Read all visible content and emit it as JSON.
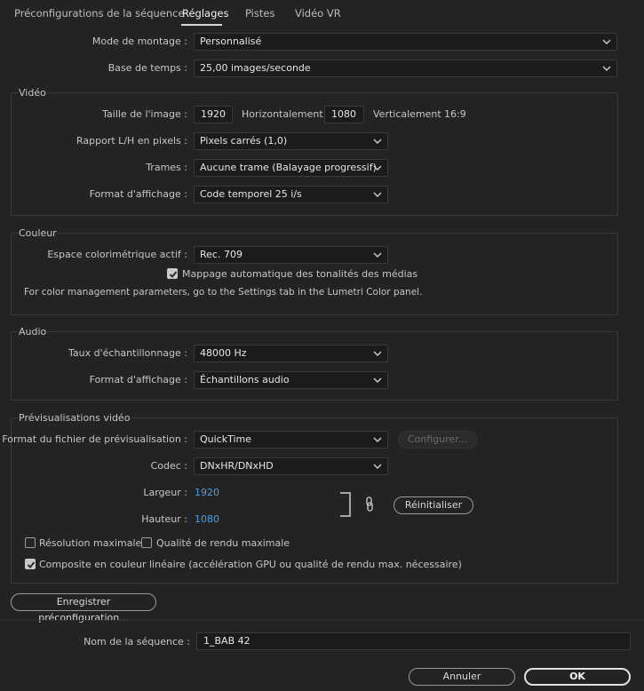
{
  "tabs": [
    {
      "label": "Préconfigurations de la séquence"
    },
    {
      "label": "Réglages"
    },
    {
      "label": "Pistes"
    },
    {
      "label": "Vidéo VR"
    }
  ],
  "general": {
    "editing_mode_label": "Mode de montage :",
    "editing_mode_value": "Personnalisé",
    "timebase_label": "Base de temps :",
    "timebase_value": "25,00  images/seconde"
  },
  "video": {
    "title": "Vidéo",
    "frame_size_label": "Taille de l'image :",
    "width_value": "1920",
    "horizontal_label": "Horizontalement",
    "height_value": "1080",
    "vertical_label": "Verticalement",
    "aspect": "16:9",
    "pixel_aspect_label": "Rapport L/H en pixels :",
    "pixel_aspect_value": "Pixels carrés (1,0)",
    "fields_label": "Trames :",
    "fields_value": "Aucune trame (Balayage progressif)",
    "display_format_label": "Format d'affichage :",
    "display_format_value": "Code temporel 25 i/s"
  },
  "color": {
    "title": "Couleur",
    "colorspace_label": "Espace colorimétrique actif :",
    "colorspace_value": "Rec. 709",
    "tone_mapping_label": "Mappage automatique des tonalités des médias",
    "tone_mapping_checked": true,
    "note": "For color management parameters, go to the Settings tab in the Lumetri Color panel."
  },
  "audio": {
    "title": "Audio",
    "sample_rate_label": "Taux d'échantillonnage :",
    "sample_rate_value": "48000 Hz",
    "display_format_label": "Format d'affichage :",
    "display_format_value": "Échantillons audio"
  },
  "preview": {
    "title": "Prévisualisations vidéo",
    "file_format_label": "Format du fichier de prévisualisation :",
    "file_format_value": "QuickTime",
    "configure_label": "Configurer...",
    "codec_label": "Codec :",
    "codec_value": "DNxHR/DNxHD",
    "width_label": "Largeur :",
    "width_value": "1920",
    "height_label": "Hauteur :",
    "height_value": "1080",
    "reset_label": "Réinitialiser",
    "max_resolution_label": "Résolution maximale",
    "max_resolution_checked": false,
    "max_quality_label": "Qualité de rendu maximale",
    "max_quality_checked": false,
    "linear_composite_label": "Composite en couleur linéaire (accélération GPU ou qualité de rendu max. nécessaire)",
    "linear_composite_checked": true
  },
  "save_preset_label": "Enregistrer préconfiguration...",
  "sequence_name_label": "Nom de la séquence :",
  "sequence_name_value": "1_BAB 42",
  "cancel_label": "Annuler",
  "ok_label": "OK",
  "colors": {
    "background": "#232323",
    "field": "#1b1b1b",
    "link_blue": "#4f9fe6"
  },
  "icons": [
    "chevron-down-icon",
    "link-icon",
    "checkmark-icon"
  ]
}
